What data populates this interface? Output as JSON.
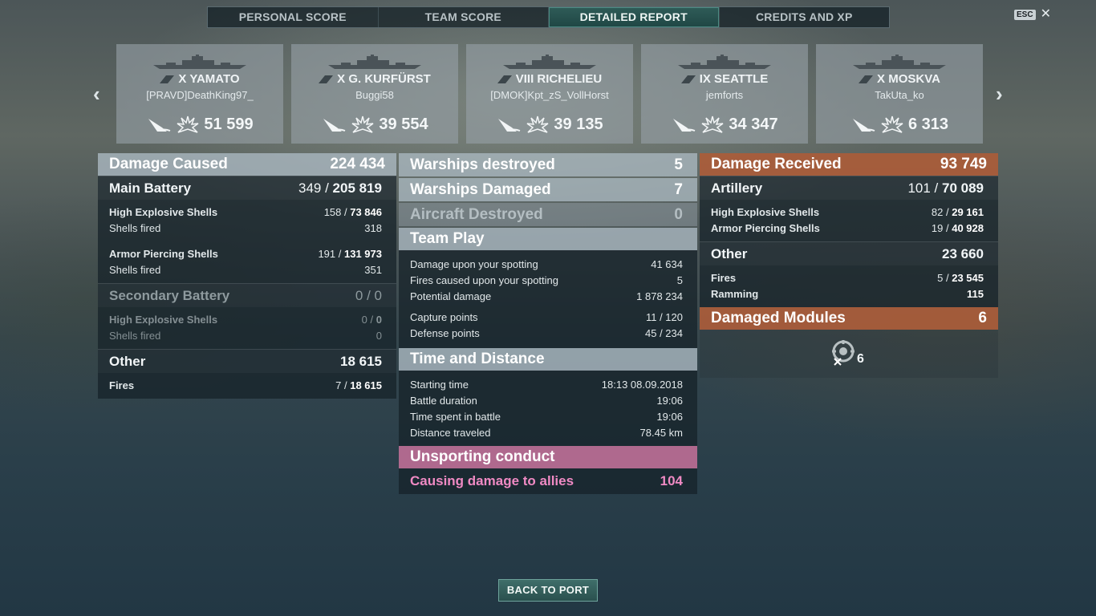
{
  "tabs": [
    "PERSONAL SCORE",
    "TEAM SCORE",
    "DETAILED REPORT",
    "CREDITS AND XP"
  ],
  "esc": {
    "key": "ESC",
    "close": "✕"
  },
  "nav": {
    "prev": "‹",
    "next": "›"
  },
  "ships": [
    {
      "name": "X YAMATO",
      "player": "[PRAVD]DeathKing97_",
      "damage": "51 599"
    },
    {
      "name": "X G. KURFÜRST",
      "player": "Buggi58",
      "damage": "39 554"
    },
    {
      "name": "VIII RICHELIEU",
      "player": "[DMOK]Kpt_zS_VollHorst",
      "damage": "39 135"
    },
    {
      "name": "IX SEATTLE",
      "player": "jemforts",
      "damage": "34 347"
    },
    {
      "name": "X MOSKVA",
      "player": "TakUta_ko",
      "damage": "6 313"
    }
  ],
  "damage_caused": {
    "title": "Damage Caused",
    "value": "224 434",
    "main_battery": {
      "label": "Main Battery",
      "hits": "349 /",
      "damage": "205 819"
    },
    "he": {
      "label": "High Explosive Shells",
      "hits": "158 /",
      "damage": "73 846",
      "fired_label": "Shells fired",
      "fired": "318"
    },
    "ap": {
      "label": "Armor Piercing Shells",
      "hits": "191 /",
      "damage": "131 973",
      "fired_label": "Shells fired",
      "fired": "351"
    },
    "secondary": {
      "label": "Secondary Battery",
      "value": "0 / 0",
      "he_label": "High Explosive Shells",
      "he_hits": "0 /",
      "he_damage": "0",
      "fired_label": "Shells fired",
      "fired": "0"
    },
    "other": {
      "label": "Other",
      "value": "18 615",
      "fires_label": "Fires",
      "fires_hits": "7 /",
      "fires_damage": "18 615"
    }
  },
  "middle": {
    "destroyed": {
      "label": "Warships destroyed",
      "value": "5"
    },
    "damaged": {
      "label": "Warships Damaged",
      "value": "7"
    },
    "aircraft": {
      "label": "Aircraft Destroyed",
      "value": "0"
    },
    "team_play": {
      "title": "Team Play",
      "rows": [
        {
          "label": "Damage upon your spotting",
          "value": "41 634"
        },
        {
          "label": "Fires caused upon your spotting",
          "value": "5"
        },
        {
          "label": "Potential damage",
          "value": "1 878 234"
        },
        {
          "label": "Capture points",
          "value": "11 / 120"
        },
        {
          "label": "Defense points",
          "value": "45 / 234"
        }
      ]
    },
    "time": {
      "title": "Time and Distance",
      "rows": [
        {
          "label": "Starting time",
          "value": "18:13  08.09.2018"
        },
        {
          "label": "Battle duration",
          "value": "19:06"
        },
        {
          "label": "Time spent in battle",
          "value": "19:06"
        },
        {
          "label": "Distance traveled",
          "value": "78.45 km"
        }
      ]
    },
    "unsporting": {
      "title": "Unsporting conduct",
      "label": "Causing damage to allies",
      "value": "104"
    }
  },
  "damage_received": {
    "title": "Damage Received",
    "value": "93 749",
    "artillery": {
      "label": "Artillery",
      "hits": "101 /",
      "damage": "70 089"
    },
    "he": {
      "label": "High Explosive Shells",
      "hits": "82 /",
      "damage": "29 161"
    },
    "ap": {
      "label": "Armor Piercing Shells",
      "hits": "19 /",
      "damage": "40 928"
    },
    "other": {
      "label": "Other",
      "value": "23 660"
    },
    "fires": {
      "label": "Fires",
      "hits": "5 /",
      "damage": "23 545"
    },
    "ramming": {
      "label": "Ramming",
      "damage": "115"
    },
    "modules": {
      "label": "Damaged Modules",
      "value": "6",
      "icon_count": "6"
    }
  },
  "back_button": "BACK TO PORT",
  "colors": {
    "accent_teal": "#2f5c58",
    "received_orange": "#aa5c3a",
    "unsporting_pink": "#be6e96",
    "ally_damage_text": "#f08ac4"
  },
  "icons": [
    "sunk-ship-icon",
    "explosion-damage-icon",
    "ship-class-icon",
    "module-damage-icon"
  ]
}
